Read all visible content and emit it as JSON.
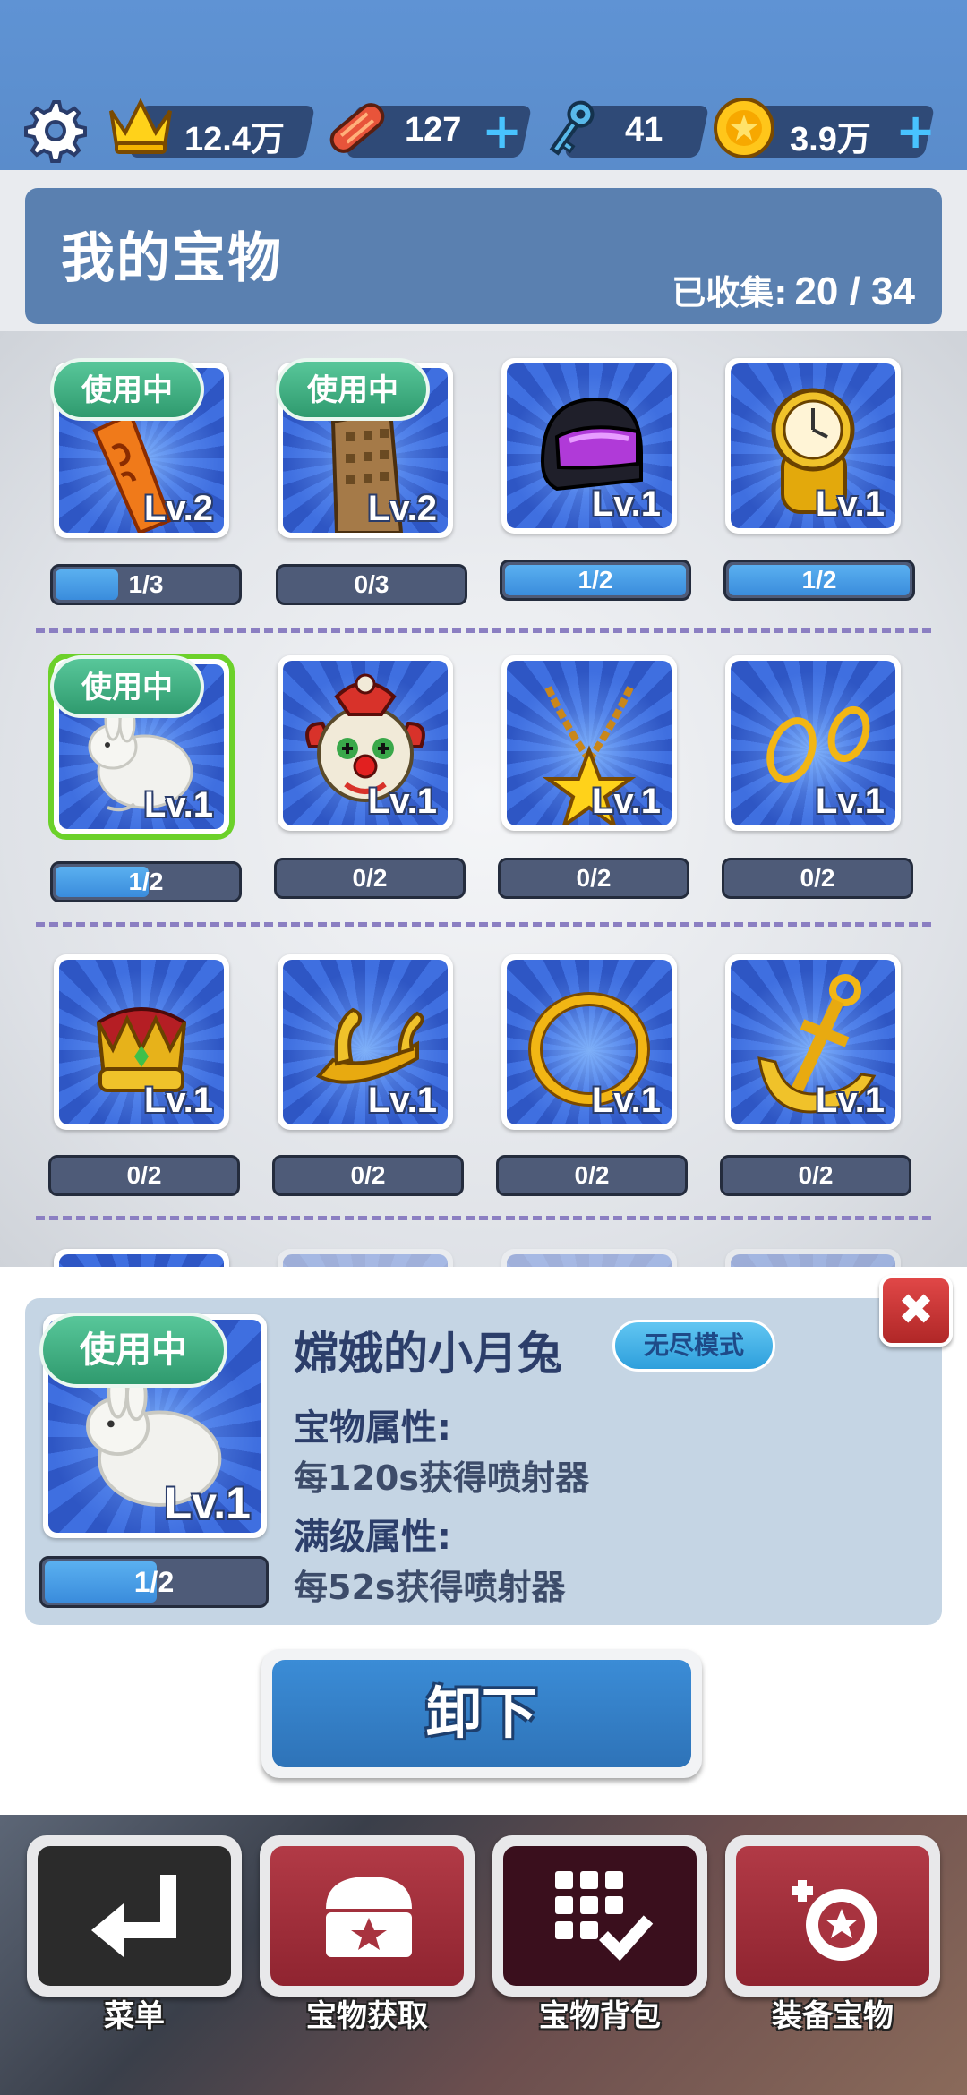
{
  "resources": {
    "crowns": "12.4万",
    "boards": "127",
    "keys": "41",
    "coins": "3.9万"
  },
  "header": {
    "title": "我的宝物",
    "collected_label": "已收集:",
    "collected_value": "20 / 34"
  },
  "in_use_label": "使用中",
  "items": [
    {
      "name": "scroll",
      "level": "Lv.2",
      "progress": "1/3",
      "fill": 0.33,
      "in_use": true
    },
    {
      "name": "skyscraper",
      "level": "Lv.2",
      "progress": "0/3",
      "fill": 0,
      "in_use": true
    },
    {
      "name": "helmet",
      "level": "Lv.1",
      "progress": "1/2",
      "fill": 1.0,
      "in_use": false
    },
    {
      "name": "gold-watch",
      "level": "Lv.1",
      "progress": "1/2",
      "fill": 1.0,
      "in_use": false
    },
    {
      "name": "moon-rabbit",
      "level": "Lv.1",
      "progress": "1/2",
      "fill": 0.5,
      "in_use": true
    },
    {
      "name": "clown-mask",
      "level": "Lv.1",
      "progress": "0/2",
      "fill": 0,
      "in_use": false
    },
    {
      "name": "star-necklace",
      "level": "Lv.1",
      "progress": "0/2",
      "fill": 0,
      "in_use": false
    },
    {
      "name": "gold-rings",
      "level": "Lv.1",
      "progress": "0/2",
      "fill": 0,
      "in_use": false
    },
    {
      "name": "crown",
      "level": "Lv.1",
      "progress": "0/2",
      "fill": 0,
      "in_use": false
    },
    {
      "name": "gold-horns",
      "level": "Lv.1",
      "progress": "0/2",
      "fill": 0,
      "in_use": false
    },
    {
      "name": "gold-ring",
      "level": "Lv.1",
      "progress": "0/2",
      "fill": 0,
      "in_use": false
    },
    {
      "name": "anchor",
      "level": "Lv.1",
      "progress": "0/2",
      "fill": 0,
      "in_use": false
    }
  ],
  "detail": {
    "in_use": "使用中",
    "level": "Lv.1",
    "progress": "1/2",
    "progress_fill": 0.5,
    "name": "嫦娥的小月兔",
    "mode": "无尽模式",
    "attr_label": "宝物属性:",
    "attr_value": "每120s获得喷射器",
    "max_label": "满级属性:",
    "max_value": "每52s获得喷射器",
    "close": "✖"
  },
  "unequip_label": "卸下",
  "nav": [
    {
      "label": "菜单",
      "icon": "return-arrow-icon",
      "color": "#2b2b2b"
    },
    {
      "label": "宝物获取",
      "icon": "treasure-chest-icon",
      "color": "#a8333f"
    },
    {
      "label": "宝物背包",
      "icon": "grid-check-icon",
      "color": "#3a0f1d"
    },
    {
      "label": "装备宝物",
      "icon": "equip-treasure-icon",
      "color": "#a8333f"
    }
  ]
}
